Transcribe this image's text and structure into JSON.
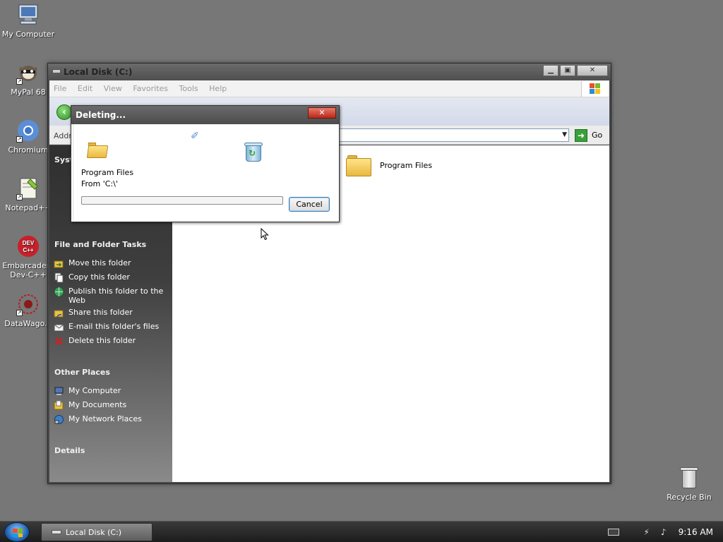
{
  "desktop": {
    "icons": [
      {
        "label": "My Computer"
      },
      {
        "label": "MyPal 68"
      },
      {
        "label": "Chromium"
      },
      {
        "label": "Notepad++"
      },
      {
        "label": "Embarcadero Dev-C++"
      },
      {
        "label": "DataWago..."
      },
      {
        "label": "Recycle Bin"
      }
    ]
  },
  "explorer": {
    "title": "Local Disk (C:)",
    "menu": [
      "File",
      "Edit",
      "View",
      "Favorites",
      "Tools",
      "Help"
    ],
    "address_label": "Addr",
    "go_label": "Go",
    "left_pane": {
      "system_tasks_title": "Syste",
      "file_folder_tasks_title": "File and Folder Tasks",
      "file_folder_tasks": [
        "Move this folder",
        "Copy this folder",
        "Publish this folder to the Web",
        "Share this folder",
        "E-mail this folder's files",
        "Delete this folder"
      ],
      "other_places_title": "Other Places",
      "other_places": [
        "My Computer",
        "My Documents",
        "My Network Places"
      ],
      "details_title": "Details"
    },
    "items": [
      {
        "name": "Program Files"
      }
    ]
  },
  "dialog": {
    "title": "Deleting...",
    "close_label": "✕",
    "item_name": "Program Files",
    "from_text": "From 'C:\\'",
    "progress": 0.0,
    "cancel_label": "Cancel"
  },
  "taskbar": {
    "window_button": "Local Disk (C:)",
    "clock": "9:16 AM"
  },
  "colors": {
    "desktop": "#777777",
    "left_pane_top": "#2f2f2f",
    "cancel_border": "#3d7bad"
  }
}
